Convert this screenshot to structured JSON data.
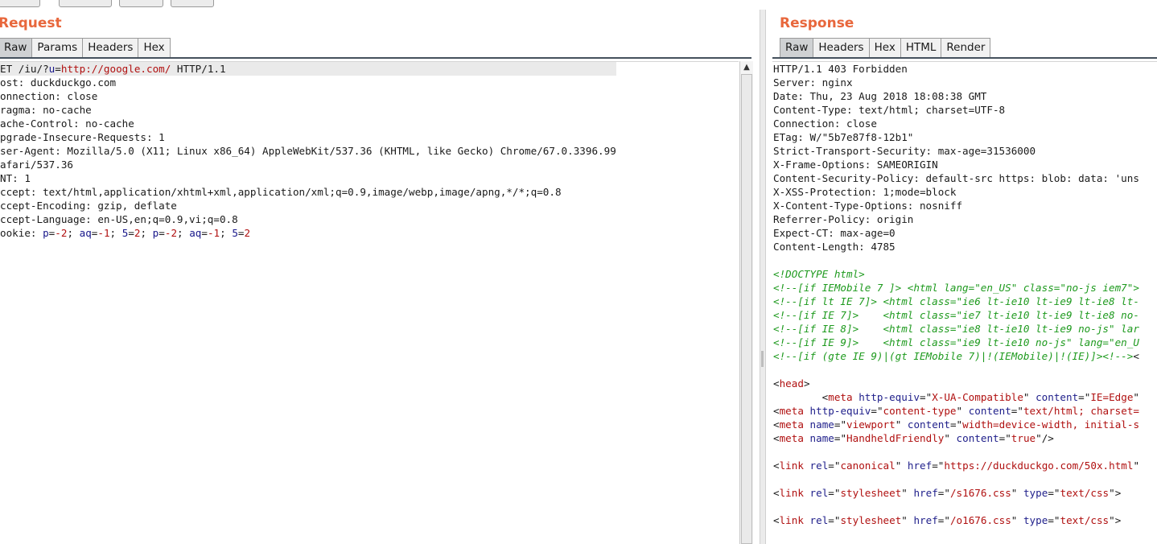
{
  "request": {
    "title": "Request",
    "tabs": [
      "Raw",
      "Params",
      "Headers",
      "Hex"
    ],
    "lines": [
      [
        [
          "t",
          "ET /iu/?"
        ],
        [
          "k",
          "u"
        ],
        [
          "t",
          "="
        ],
        [
          "v",
          "http://google.com/"
        ],
        [
          "t",
          " HTTP/1.1"
        ]
      ],
      [
        [
          "t",
          "ost: duckduckgo.com"
        ]
      ],
      [
        [
          "t",
          "onnection: close"
        ]
      ],
      [
        [
          "t",
          "ragma: no-cache"
        ]
      ],
      [
        [
          "t",
          "ache-Control: no-cache"
        ]
      ],
      [
        [
          "t",
          "pgrade-Insecure-Requests: 1"
        ]
      ],
      [
        [
          "t",
          "ser-Agent: Mozilla/5.0 (X11; Linux x86_64) AppleWebKit/537.36 (KHTML, like Gecko) Chrome/67.0.3396.99"
        ]
      ],
      [
        [
          "t",
          "afari/537.36"
        ]
      ],
      [
        [
          "t",
          "NT: 1"
        ]
      ],
      [
        [
          "t",
          "ccept: text/html,application/xhtml+xml,application/xml;q=0.9,image/webp,image/apng,*/*;q=0.8"
        ]
      ],
      [
        [
          "t",
          "ccept-Encoding: gzip, deflate"
        ]
      ],
      [
        [
          "t",
          "ccept-Language: en-US,en;q=0.9,vi;q=0.8"
        ]
      ],
      [
        [
          "t",
          "ookie: "
        ],
        [
          "k",
          "p"
        ],
        [
          "t",
          "="
        ],
        [
          "v",
          "-2"
        ],
        [
          "t",
          "; "
        ],
        [
          "k",
          "aq"
        ],
        [
          "t",
          "="
        ],
        [
          "v",
          "-1"
        ],
        [
          "t",
          "; "
        ],
        [
          "k",
          "5"
        ],
        [
          "t",
          "="
        ],
        [
          "v",
          "2"
        ],
        [
          "t",
          "; "
        ],
        [
          "k",
          "p"
        ],
        [
          "t",
          "="
        ],
        [
          "v",
          "-2"
        ],
        [
          "t",
          "; "
        ],
        [
          "k",
          "aq"
        ],
        [
          "t",
          "="
        ],
        [
          "v",
          "-1"
        ],
        [
          "t",
          "; "
        ],
        [
          "k",
          "5"
        ],
        [
          "t",
          "="
        ],
        [
          "v",
          "2"
        ]
      ]
    ]
  },
  "response": {
    "title": "Response",
    "tabs": [
      "Raw",
      "Headers",
      "Hex",
      "HTML",
      "Render"
    ],
    "lines": [
      [
        [
          "t",
          "HTTP/1.1 403 Forbidden"
        ]
      ],
      [
        [
          "t",
          "Server: nginx"
        ]
      ],
      [
        [
          "t",
          "Date: Thu, 23 Aug 2018 18:08:38 GMT"
        ]
      ],
      [
        [
          "t",
          "Content-Type: text/html; charset=UTF-8"
        ]
      ],
      [
        [
          "t",
          "Connection: close"
        ]
      ],
      [
        [
          "t",
          "ETag: W/\"5b7e87f8-12b1\""
        ]
      ],
      [
        [
          "t",
          "Strict-Transport-Security: max-age=31536000"
        ]
      ],
      [
        [
          "t",
          "X-Frame-Options: SAMEORIGIN"
        ]
      ],
      [
        [
          "t",
          "Content-Security-Policy: default-src https: blob: data: 'uns"
        ]
      ],
      [
        [
          "t",
          "X-XSS-Protection: 1;mode=block"
        ]
      ],
      [
        [
          "t",
          "X-Content-Type-Options: nosniff"
        ]
      ],
      [
        [
          "t",
          "Referrer-Policy: origin"
        ]
      ],
      [
        [
          "t",
          "Expect-CT: max-age=0"
        ]
      ],
      [
        [
          "t",
          "Content-Length: 4785"
        ]
      ],
      [
        [
          "t",
          ""
        ]
      ],
      [
        [
          "cm",
          "<!DOCTYPE html>"
        ]
      ],
      [
        [
          "cm",
          "<!--[if IEMobile 7 ]> <html lang=\"en_US\" class=\"no-js iem7\">"
        ]
      ],
      [
        [
          "cm",
          "<!--[if lt IE 7]> <html class=\"ie6 lt-ie10 lt-ie9 lt-ie8 lt-"
        ]
      ],
      [
        [
          "cm",
          "<!--[if IE 7]>    <html class=\"ie7 lt-ie10 lt-ie9 lt-ie8 no-"
        ]
      ],
      [
        [
          "cm",
          "<!--[if IE 8]>    <html class=\"ie8 lt-ie10 lt-ie9 no-js\" lar"
        ]
      ],
      [
        [
          "cm",
          "<!--[if IE 9]>    <html class=\"ie9 lt-ie10 no-js\" lang=\"en_U"
        ]
      ],
      [
        [
          "cm",
          "<!--[if (gte IE 9)|(gt IEMobile 7)|!(IEMobile)|!(IE)]><!-->"
        ],
        [
          "t",
          "<"
        ]
      ],
      [
        [
          "t",
          ""
        ]
      ],
      [
        [
          "t",
          "<"
        ],
        [
          "v",
          "head"
        ],
        [
          "t",
          ">"
        ]
      ],
      [
        [
          "t",
          "        <"
        ],
        [
          "v",
          "meta"
        ],
        [
          "t",
          " "
        ],
        [
          "val",
          "http-equiv"
        ],
        [
          "t",
          "=\""
        ],
        [
          "v",
          "X-UA-Compatible"
        ],
        [
          "t",
          "\" "
        ],
        [
          "val",
          "content"
        ],
        [
          "t",
          "=\""
        ],
        [
          "v",
          "IE=Edge"
        ],
        [
          "t",
          "\""
        ]
      ],
      [
        [
          "t",
          "<"
        ],
        [
          "v",
          "meta"
        ],
        [
          "t",
          " "
        ],
        [
          "val",
          "http-equiv"
        ],
        [
          "t",
          "=\""
        ],
        [
          "v",
          "content-type"
        ],
        [
          "t",
          "\" "
        ],
        [
          "val",
          "content"
        ],
        [
          "t",
          "=\""
        ],
        [
          "v",
          "text/html; charset="
        ]
      ],
      [
        [
          "t",
          "<"
        ],
        [
          "v",
          "meta"
        ],
        [
          "t",
          " "
        ],
        [
          "val",
          "name"
        ],
        [
          "t",
          "=\""
        ],
        [
          "v",
          "viewport"
        ],
        [
          "t",
          "\" "
        ],
        [
          "val",
          "content"
        ],
        [
          "t",
          "=\""
        ],
        [
          "v",
          "width=device-width, initial-s"
        ]
      ],
      [
        [
          "t",
          "<"
        ],
        [
          "v",
          "meta"
        ],
        [
          "t",
          " "
        ],
        [
          "val",
          "name"
        ],
        [
          "t",
          "=\""
        ],
        [
          "v",
          "HandheldFriendly"
        ],
        [
          "t",
          "\" "
        ],
        [
          "val",
          "content"
        ],
        [
          "t",
          "=\""
        ],
        [
          "v",
          "true"
        ],
        [
          "t",
          "\"/>"
        ]
      ],
      [
        [
          "t",
          ""
        ]
      ],
      [
        [
          "t",
          "<"
        ],
        [
          "v",
          "link"
        ],
        [
          "t",
          " "
        ],
        [
          "val",
          "rel"
        ],
        [
          "t",
          "=\""
        ],
        [
          "v",
          "canonical"
        ],
        [
          "t",
          "\" "
        ],
        [
          "val",
          "href"
        ],
        [
          "t",
          "=\""
        ],
        [
          "v",
          "https://duckduckgo.com/50x.html"
        ],
        [
          "t",
          "\""
        ]
      ],
      [
        [
          "t",
          ""
        ]
      ],
      [
        [
          "t",
          "<"
        ],
        [
          "v",
          "link"
        ],
        [
          "t",
          " "
        ],
        [
          "val",
          "rel"
        ],
        [
          "t",
          "=\""
        ],
        [
          "v",
          "stylesheet"
        ],
        [
          "t",
          "\" "
        ],
        [
          "val",
          "href"
        ],
        [
          "t",
          "=\""
        ],
        [
          "v",
          "/s1676.css"
        ],
        [
          "t",
          "\" "
        ],
        [
          "val",
          "type"
        ],
        [
          "t",
          "=\""
        ],
        [
          "v",
          "text/css"
        ],
        [
          "t",
          "\">"
        ]
      ],
      [
        [
          "t",
          ""
        ]
      ],
      [
        [
          "t",
          "<"
        ],
        [
          "v",
          "link"
        ],
        [
          "t",
          " "
        ],
        [
          "val",
          "rel"
        ],
        [
          "t",
          "=\""
        ],
        [
          "v",
          "stylesheet"
        ],
        [
          "t",
          "\" "
        ],
        [
          "val",
          "href"
        ],
        [
          "t",
          "=\""
        ],
        [
          "v",
          "/o1676.css"
        ],
        [
          "t",
          "\" "
        ],
        [
          "val",
          "type"
        ],
        [
          "t",
          "=\""
        ],
        [
          "v",
          "text/css"
        ],
        [
          "t",
          "\">"
        ]
      ]
    ]
  },
  "icons": {
    "scroll_up": "up-arrow-icon"
  }
}
